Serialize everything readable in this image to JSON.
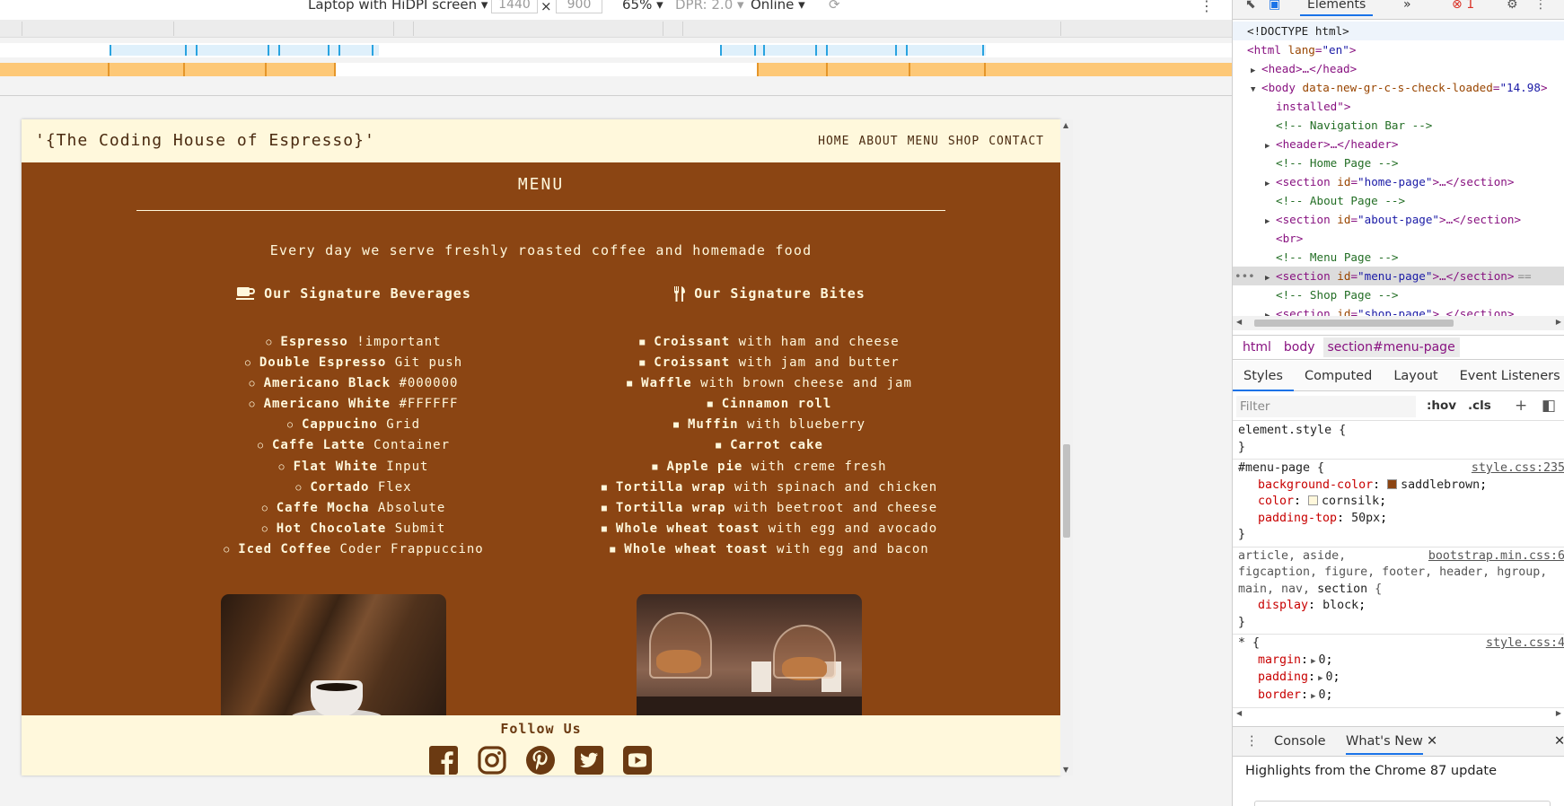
{
  "device_toolbar": {
    "device": "Laptop with HiDPI screen",
    "width": "1440",
    "times": "×",
    "height": "900",
    "zoom": "65%",
    "dpr": "DPR: 2.0",
    "network": "Online",
    "kebab": "⋮"
  },
  "site": {
    "brand": "'{The Coding House of Espresso}'",
    "nav": [
      "HOME",
      "ABOUT",
      "MENU",
      "SHOP",
      "CONTACT"
    ],
    "menu_title": "MENU",
    "menu_subtitle": "Every day we serve freshly roasted coffee and homemade food",
    "beverages": {
      "heading": "Our Signature Beverages",
      "icon": "coffee-cup-icon",
      "items": [
        {
          "name": "Espresso",
          "desc": "!important"
        },
        {
          "name": "Double Espresso",
          "desc": "Git push"
        },
        {
          "name": "Americano Black",
          "desc": "#000000"
        },
        {
          "name": "Americano White",
          "desc": "#FFFFFF"
        },
        {
          "name": "Cappucino",
          "desc": "Grid"
        },
        {
          "name": "Caffe Latte",
          "desc": "Container"
        },
        {
          "name": "Flat White",
          "desc": "Input"
        },
        {
          "name": "Cortado",
          "desc": "Flex"
        },
        {
          "name": "Caffe Mocha",
          "desc": "Absolute"
        },
        {
          "name": "Hot Chocolate",
          "desc": "Submit"
        },
        {
          "name": "Iced Coffee",
          "desc": "Coder Frappuccino"
        }
      ]
    },
    "bites": {
      "heading": "Our Signature Bites",
      "icon": "utensils-icon",
      "items": [
        {
          "name": "Croissant",
          "desc": "with ham and cheese"
        },
        {
          "name": "Croissant",
          "desc": "with jam and butter"
        },
        {
          "name": "Waffle",
          "desc": "with brown cheese and jam"
        },
        {
          "name": "Cinnamon roll",
          "desc": ""
        },
        {
          "name": "Muffin",
          "desc": "with blueberry"
        },
        {
          "name": "Carrot cake",
          "desc": ""
        },
        {
          "name": "Apple pie",
          "desc": "with creme fresh"
        },
        {
          "name": "Tortilla wrap",
          "desc": "with spinach and chicken"
        },
        {
          "name": "Tortilla wrap",
          "desc": "with beetroot and cheese"
        },
        {
          "name": "Whole wheat toast",
          "desc": "with egg and avocado"
        },
        {
          "name": "Whole wheat toast",
          "desc": "with egg and bacon"
        }
      ]
    },
    "footer": {
      "follow": "Follow Us",
      "socials": [
        "facebook-icon",
        "instagram-icon",
        "pinterest-icon",
        "twitter-icon",
        "youtube-icon"
      ]
    }
  },
  "devtools": {
    "tabs": {
      "elements": "Elements",
      "more": "»",
      "errors": "1"
    },
    "dom": [
      {
        "text": "<!DOCTYPE html>"
      },
      {
        "tag": "html",
        "attr": "lang",
        "val": "\"en\""
      },
      {
        "tag": "head",
        "collapsed": "…</head>"
      },
      {
        "tag": "body",
        "attr": "data-new-gr-c-s-check-loaded",
        "val": "\"14.98"
      },
      {
        "text": "installed\">"
      },
      {
        "comment": "<!-- Navigation Bar -->"
      },
      {
        "tag": "header",
        "collapsed": "…</header>"
      },
      {
        "comment": "<!-- Home Page -->"
      },
      {
        "tag": "section",
        "attr": "id",
        "val": "\"home-page\"",
        "collapsed": "…</section>"
      },
      {
        "comment": "<!-- About Page -->"
      },
      {
        "tag": "section",
        "attr": "id",
        "val": "\"about-page\"",
        "collapsed": "…</section>"
      },
      {
        "text": "<br>"
      },
      {
        "comment": "<!-- Menu Page -->"
      },
      {
        "tag": "section",
        "attr": "id",
        "val": "\"menu-page\"",
        "collapsed": "…</section>",
        "suffix": "=="
      },
      {
        "comment": "<!-- Shop Page -->"
      },
      {
        "tag": "section",
        "attr": "id",
        "val": "\"shop-page\"",
        "collapsed": "…</section>"
      }
    ],
    "breadcrumbs": [
      "html",
      "body",
      "section#menu-page"
    ],
    "panel_tabs": [
      "Styles",
      "Computed",
      "Layout",
      "Event Listeners",
      "»"
    ],
    "filter_placeholder": "Filter",
    "filter_hov": ":hov",
    "filter_cls": ".cls",
    "styles": {
      "element_style": "element.style {",
      "menu_page_selector": "#menu-page {",
      "menu_page_source": "style.css:235",
      "menu_page_decls": [
        {
          "prop": "background-color",
          "val": "saddlebrown",
          "swatch": "#8b4513"
        },
        {
          "prop": "color",
          "val": "cornsilk",
          "swatch": "#fff8dc"
        },
        {
          "prop": "padding-top",
          "val": "50px"
        }
      ],
      "bootstrap_selector_1": "article, aside,",
      "bootstrap_selector_2": "figcaption, figure, footer, header, hgroup,",
      "bootstrap_selector_3a": "main, nav,",
      "bootstrap_selector_3b": "section",
      "bootstrap_source": "bootstrap.min.css:6",
      "bootstrap_decl": {
        "prop": "display",
        "val": "block"
      },
      "star_selector": "* {",
      "star_source": "style.css:4",
      "star_decls": [
        {
          "prop": "margin",
          "val": "0"
        },
        {
          "prop": "padding",
          "val": "0"
        },
        {
          "prop": "border",
          "val": "0"
        }
      ]
    },
    "drawer": {
      "console": "Console",
      "whats_new": "What's New",
      "highlights": "Highlights from the Chrome 87 update"
    }
  }
}
